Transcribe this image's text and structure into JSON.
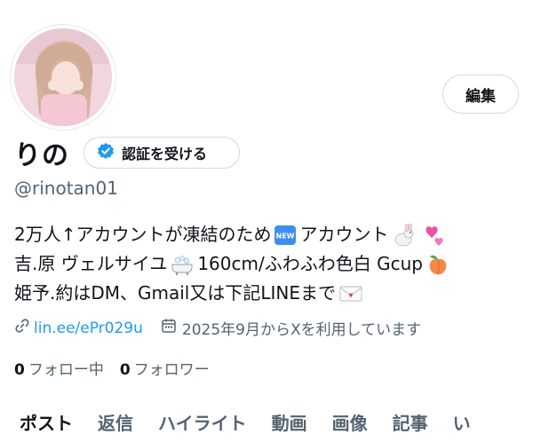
{
  "profile": {
    "name": "りの",
    "handle": "@rinotan01",
    "edit_label": "編集",
    "verify_label": "認証を受ける",
    "bio": {
      "line1": {
        "a": "2万人↑アカウントが凍結のため",
        "b": "アカウント"
      },
      "line2": {
        "a": "吉.原 ヴェルサイユ",
        "b": "160cm/ふわふわ色白 Gcup"
      },
      "line3": {
        "a": "姫予.約はDM、Gmail又は下記LINEまで"
      }
    },
    "link": "lin.ee/ePr029u",
    "joined": "2025年9月からXを利用しています",
    "following_count": "0",
    "following_label": "フォロー中",
    "followers_count": "0",
    "followers_label": "フォロワー"
  },
  "icons": {
    "verify": "verified-badge-icon",
    "link": "link-icon",
    "calendar": "calendar-icon",
    "new": "new-badge-icon",
    "rabbit": "rabbit-icon",
    "hearts": "revolving-hearts-icon",
    "bathtub": "bathtub-icon",
    "peach": "peach-icon",
    "envelope": "love-letter-icon"
  },
  "tabs": [
    "ポスト",
    "返信",
    "ハイライト",
    "動画",
    "画像",
    "記事",
    "い"
  ],
  "colors": {
    "accent": "#1d9bf0",
    "muted": "#536471",
    "text": "#0f1419"
  }
}
